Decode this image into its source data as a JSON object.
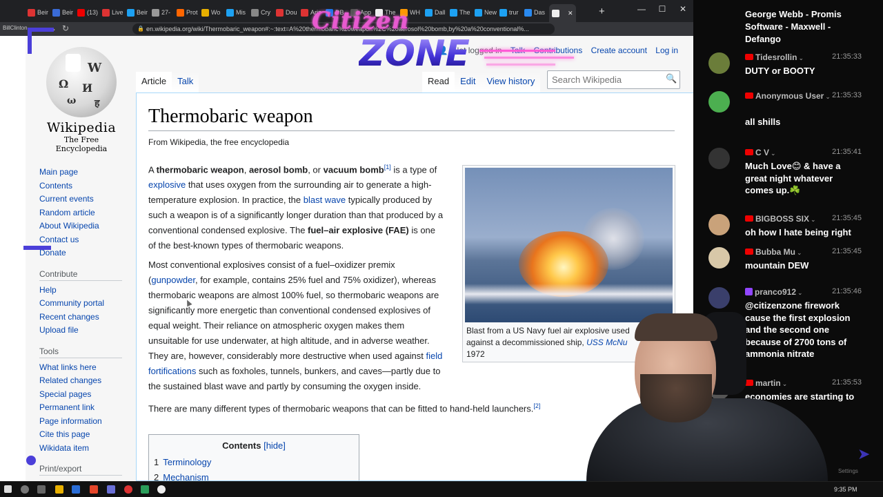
{
  "browser": {
    "tabs": [
      {
        "label": "Beir",
        "color": "#d33"
      },
      {
        "label": "Beir",
        "color": "#3a6bd6"
      },
      {
        "label": "(13)",
        "color": "#e00"
      },
      {
        "label": "Live",
        "color": "#d33"
      },
      {
        "label": "Beir",
        "color": "#1da1f2"
      },
      {
        "label": "27-",
        "color": "#999"
      },
      {
        "label": "Prot",
        "color": "#f60"
      },
      {
        "label": "Wo",
        "color": "#e8b000"
      },
      {
        "label": "Mis",
        "color": "#1da1f2"
      },
      {
        "label": "Cry",
        "color": "#888"
      },
      {
        "label": "Dou",
        "color": "#d33"
      },
      {
        "label": "Ariz",
        "color": "#d33"
      },
      {
        "label": "DB",
        "color": "#1a73e8"
      },
      {
        "label": "App",
        "color": "#555"
      },
      {
        "label": "The",
        "color": "#eee"
      },
      {
        "label": "WH",
        "color": "#f90"
      },
      {
        "label": "Dall",
        "color": "#1da1f2"
      },
      {
        "label": "The",
        "color": "#1da1f2"
      },
      {
        "label": "New",
        "color": "#1da1f2"
      },
      {
        "label": "trur",
        "color": "#1da1f2"
      },
      {
        "label": "Das",
        "color": "#2a8af0"
      },
      {
        "label": "",
        "color": "#eee"
      }
    ],
    "tab_close": "✕",
    "new_tab": "+",
    "window_controls": {
      "minimize": "—",
      "maximize": "☐",
      "close": "✕"
    },
    "url": "en.wikipedia.org/wiki/Thermobaric_weapon#:~:text=A%20thermobaric%20weapon%2C%20aerosol%20bomb,by%20a%20conventional%...",
    "profile_label": "BillClinton",
    "nav": {
      "back": "←",
      "forward": "→",
      "reload": "↻"
    }
  },
  "wiki": {
    "personal": {
      "not_logged_in": "Not logged in",
      "talk": "Talk",
      "contributions": "Contributions",
      "create_account": "Create account",
      "log_in": "Log in"
    },
    "logo": {
      "wordmark": "Wikipedia",
      "tagline": "The Free Encyclopedia"
    },
    "nav_main": [
      "Main page",
      "Contents",
      "Current events",
      "Random article",
      "About Wikipedia",
      "Contact us",
      "Donate"
    ],
    "contribute_heading": "Contribute",
    "nav_contribute": [
      "Help",
      "Community portal",
      "Recent changes",
      "Upload file"
    ],
    "tools_heading": "Tools",
    "nav_tools": [
      "What links here",
      "Related changes",
      "Special pages",
      "Permanent link",
      "Page information",
      "Cite this page",
      "Wikidata item"
    ],
    "print_heading": "Print/export",
    "tabs_left": [
      "Article",
      "Talk"
    ],
    "tabs_right": [
      "Read",
      "Edit",
      "View history"
    ],
    "search_placeholder": "Search Wikipedia",
    "title": "Thermobaric weapon",
    "site_sub": "From Wikipedia, the free encyclopedia",
    "p1": {
      "a": "A ",
      "b1": "thermobaric weapon",
      "c1": ", ",
      "b2": "aerosol bomb",
      "c2": ", or ",
      "b3": "vacuum bomb",
      "ref1": "[1]",
      "c3": " is a type of ",
      "link_explosive": "explosive",
      "c4": " that uses oxygen from the surrounding air to generate a high-temperature explosion. In practice, the ",
      "link_blast": "blast wave",
      "c5": " typically produced by such a weapon is of a significantly longer duration than that produced by a conventional condensed explosive. The ",
      "b4": "fuel–air explosive (FAE)",
      "c6": " is one of the best-known types of thermobaric weapons."
    },
    "p2": {
      "a": "Most conventional explosives consist of a fuel–oxidizer premix (",
      "link_gunpowder": "gunpowder",
      "b": ", for example, contains 25% fuel and 75% oxidizer), whereas thermobaric weapons are almost 100% fuel, so thermobaric weapons are significantly more energetic than conventional condensed explosives of equal weight. Their reliance on atmospheric oxygen makes them unsuitable for use underwater, at high altitude, and in adverse weather. They are, however, considerably more destructive when used against ",
      "link_field": "field fortifications",
      "c": " such as foxholes, tunnels, bunkers, and caves—partly due to the sustained blast wave and partly by consuming the oxygen inside."
    },
    "p3": {
      "a": "There are many different types of thermobaric weapons that can be fitted to hand-held launchers.",
      "ref2": "[2]"
    },
    "thumb_caption": {
      "a": "Blast from a US Navy fuel air explosive used against a decommissioned ship, ",
      "link": "USS McNu",
      "b": "1972"
    },
    "toc": {
      "title": "Contents",
      "hide": "[hide]",
      "items": [
        {
          "num": "1",
          "text": "Terminology"
        },
        {
          "num": "2",
          "text": "Mechanism"
        }
      ]
    }
  },
  "overlay": {
    "logo_line1": "Citizen",
    "logo_line2": "ZONE",
    "accent_pink": "#ff5bd6",
    "accent_blue": "#4b3fd9"
  },
  "chat": {
    "top_text": "George Webb - Promis Software - Maxwell - Defango",
    "messages": [
      {
        "user": "Tidesrollin",
        "time": "21:35:33",
        "text": "DUTY or BOOTY",
        "platform": "youtube",
        "avatar": "#6b7d3a"
      },
      {
        "user": "Anonymous User",
        "time": "21:35:33",
        "text": "all shills",
        "platform": "youtube",
        "avatar": "#4caf50"
      },
      {
        "user": "C V",
        "time": "21:35:41",
        "text": "Much Love😊 & have a great night whatever comes up.☘️",
        "platform": "youtube",
        "avatar": "#333333"
      },
      {
        "user": "BIGBOSS SIX",
        "time": "21:35:45",
        "text": "oh how I hate being right",
        "platform": "youtube",
        "avatar": "#c9a27a"
      },
      {
        "user": "Bubba Mu",
        "time": "21:35:45",
        "text": "mountain DEW",
        "platform": "youtube",
        "avatar": "#d8c8a8"
      },
      {
        "user": "pranco912",
        "time": "21:35:46",
        "text": "@citizenzone firework cause the first explosion and the second one because of 2700 tons of ammonia nitrate",
        "platform": "twitch",
        "avatar": "#3a3f6b"
      },
      {
        "user": "martin",
        "time": "21:35:53",
        "text": "economies are starting to start",
        "platform": "youtube",
        "avatar": "#555555"
      }
    ],
    "settings_label": "Settings"
  },
  "taskbar": {
    "clock": "9:35 PM"
  }
}
